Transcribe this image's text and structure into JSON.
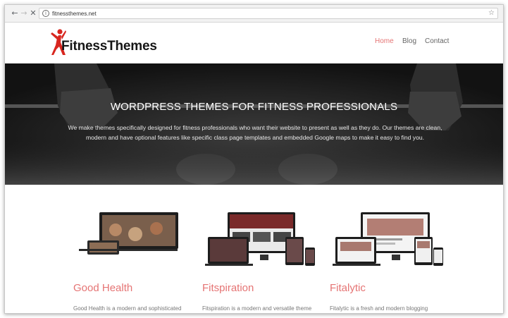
{
  "browser": {
    "back_icon": "arrow-left-icon",
    "forward_icon": "arrow-right-icon",
    "stop_icon": "close-icon",
    "info_icon": "info-icon",
    "bookmark_icon": "star-icon",
    "url": "fitnessthemes.net"
  },
  "site": {
    "logo_text": "FitnessThemes",
    "logo_colors": {
      "figure": "#d8261f",
      "text": "#161616"
    },
    "nav": [
      {
        "label": "Home",
        "active": true
      },
      {
        "label": "Blog",
        "active": false
      },
      {
        "label": "Contact",
        "active": false
      }
    ],
    "nav_colors": {
      "active": "#e57474",
      "inactive": "#666666"
    }
  },
  "hero": {
    "title": "WORDPRESS THEMES FOR FITNESS PROFESSIONALS",
    "description": "We make themes specifically designed for fitness professionals who want their website to present as well as they do. Our themes are clean, modern and have optional features like specific class page templates and embedded Google maps to make it easy to find you."
  },
  "themes": [
    {
      "name": "Good Health",
      "description": "Good Health is a modern and sophisticated"
    },
    {
      "name": "Fitspiration",
      "description": "Fitspiration is a modern and versatile theme"
    },
    {
      "name": "Fitalytic",
      "description": "Fitalytic is a fresh and modern blogging"
    }
  ],
  "accent_color": "#e57474"
}
